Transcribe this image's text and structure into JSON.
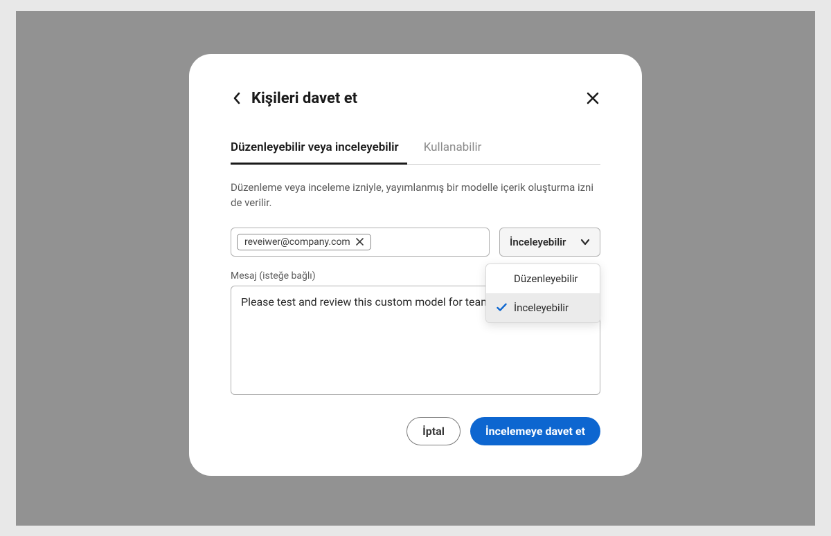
{
  "dialog": {
    "title": "Kişileri davet et",
    "tabs": {
      "edit_review": "Düzenleyebilir veya inceleyebilir",
      "use": "Kullanabilir"
    },
    "description": "Düzenleme veya inceleme izniyle, yayımlanmış bir modelle içerik oluşturma izni de verilir.",
    "email_chip": "reveiwer@company.com",
    "permission_selected": "İnceleyebilir",
    "permission_options": {
      "edit": "Düzenleyebilir",
      "review": "İnceleyebilir"
    },
    "message_label": "Mesaj (isteğe bağlı)",
    "message_value": "Please test and review this custom model for team",
    "actions": {
      "cancel": "İptal",
      "submit": "İncelemeye davet et"
    }
  }
}
